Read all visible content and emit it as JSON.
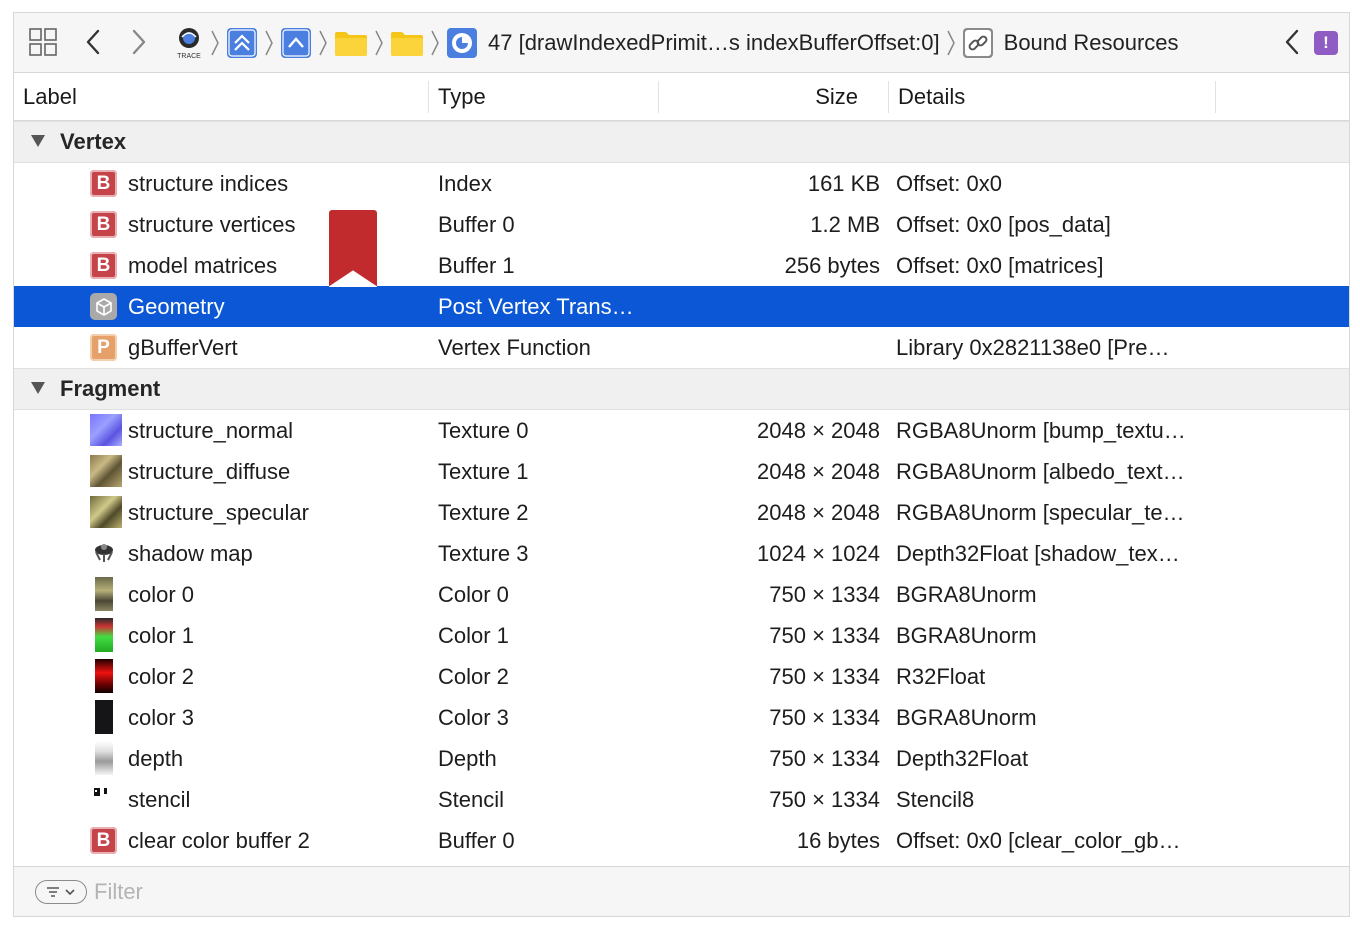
{
  "toolbar": {
    "breadcrumb_draw_call": "47 [drawIndexedPrimit…s indexBufferOffset:0]",
    "breadcrumb_last": "Bound Resources",
    "trace_icon_label": "TRACE",
    "issue_badge": "!"
  },
  "columns": {
    "label": "Label",
    "type": "Type",
    "size": "Size",
    "details": "Details"
  },
  "groups": [
    {
      "label": "Vertex",
      "rows": [
        {
          "icon": "buffer-icon",
          "label": "structure indices",
          "type": "Index",
          "size": "161 KB",
          "details": "Offset: 0x0"
        },
        {
          "icon": "buffer-icon",
          "label": "structure vertices",
          "type": "Buffer 0",
          "size": "1.2 MB",
          "details": "Offset: 0x0 [pos_data]"
        },
        {
          "icon": "buffer-icon",
          "label": "model matrices",
          "type": "Buffer 1",
          "size": "256 bytes",
          "details": "Offset: 0x0 [matrices]"
        },
        {
          "icon": "geometry-cube-icon",
          "label": "Geometry",
          "type": "Post Vertex Trans…",
          "size": "",
          "details": "",
          "selected": true
        },
        {
          "icon": "program-icon",
          "label": "gBufferVert",
          "type": "Vertex Function",
          "size": "",
          "details": "Library 0x2821138e0 [Pre…"
        }
      ]
    },
    {
      "label": "Fragment",
      "rows": [
        {
          "icon": "texture-normal-thumbnail",
          "label": "structure_normal",
          "type": "Texture 0",
          "size": "2048 × 2048",
          "details": "RGBA8Unorm [bump_textu…"
        },
        {
          "icon": "texture-diffuse-thumbnail",
          "label": "structure_diffuse",
          "type": "Texture 1",
          "size": "2048 × 2048",
          "details": "RGBA8Unorm [albedo_text…"
        },
        {
          "icon": "texture-specular-thumbnail",
          "label": "structure_specular",
          "type": "Texture 2",
          "size": "2048 × 2048",
          "details": "RGBA8Unorm [specular_te…"
        },
        {
          "icon": "shadow-map-thumbnail",
          "label": "shadow map",
          "type": "Texture 3",
          "size": "1024 × 1024",
          "details": "Depth32Float [shadow_tex…"
        },
        {
          "icon": "color0-thumbnail",
          "label": "color 0",
          "type": "Color 0",
          "size": "750 × 1334",
          "details": "BGRA8Unorm"
        },
        {
          "icon": "color1-thumbnail",
          "label": "color 1",
          "type": "Color 1",
          "size": "750 × 1334",
          "details": "BGRA8Unorm"
        },
        {
          "icon": "color2-thumbnail",
          "label": "color 2",
          "type": "Color 2",
          "size": "750 × 1334",
          "details": "R32Float"
        },
        {
          "icon": "color3-thumbnail",
          "label": "color 3",
          "type": "Color 3",
          "size": "750 × 1334",
          "details": "BGRA8Unorm"
        },
        {
          "icon": "depth-thumbnail",
          "label": "depth",
          "type": "Depth",
          "size": "750 × 1334",
          "details": "Depth32Float"
        },
        {
          "icon": "stencil-thumbnail",
          "label": "stencil",
          "type": "Stencil",
          "size": "750 × 1334",
          "details": "Stencil8"
        },
        {
          "icon": "buffer-icon",
          "label": "clear color buffer 2",
          "type": "Buffer 0",
          "size": "16 bytes",
          "details": "Offset: 0x0 [clear_color_gb…"
        }
      ]
    }
  ],
  "filter": {
    "placeholder": "Filter",
    "value": ""
  },
  "colors": {
    "selection": "#0b57d6",
    "buffer_icon": "#c4444a",
    "program_icon": "#e6a06a",
    "bookmark": "#c22b2e",
    "breadcrumb_blue": "#4a7fe0",
    "folder_yellow": "#f5c518",
    "issue_purple": "#8e5cc3"
  }
}
